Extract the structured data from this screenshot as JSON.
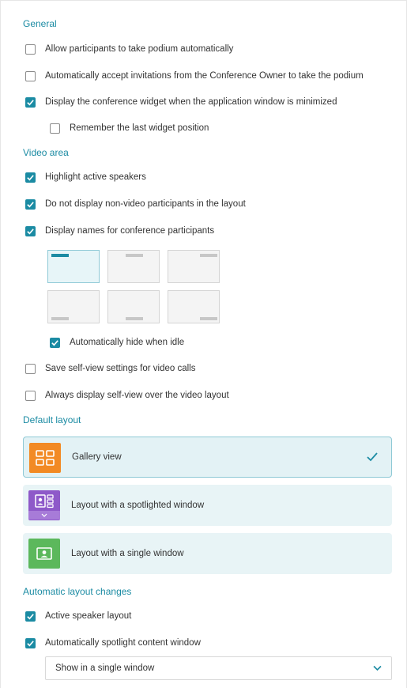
{
  "colors": {
    "accent": "#1b8ba3",
    "gallery_icon_bg": "#f28a24",
    "spotlight_icon_bg": "#8e59c9",
    "single_icon_bg": "#5cb85c"
  },
  "general": {
    "title": "General",
    "options": [
      {
        "label": "Allow participants to take podium automatically",
        "checked": false
      },
      {
        "label": "Automatically accept invitations from the Conference Owner to take the podium",
        "checked": false
      },
      {
        "label": "Display the conference widget when the application window is minimized",
        "checked": true
      },
      {
        "label": "Remember the last widget position",
        "checked": false
      }
    ]
  },
  "video_area": {
    "title": "Video area",
    "options": [
      {
        "label": "Highlight active speakers",
        "checked": true
      },
      {
        "label": "Do not display non-video participants in the layout",
        "checked": true
      },
      {
        "label": "Display names for conference participants",
        "checked": true
      },
      {
        "label": "Automatically hide when idle",
        "checked": true
      },
      {
        "label": "Save self-view settings for video calls",
        "checked": false
      },
      {
        "label": "Always display self-view over the video layout",
        "checked": false
      }
    ],
    "name_position_selected": "top-left"
  },
  "default_layout": {
    "title": "Default layout",
    "items": [
      {
        "label": "Gallery view",
        "icon": "gallery-icon",
        "selected": true
      },
      {
        "label": "Layout with a spotlighted window",
        "icon": "spotlight-layout-icon",
        "selected": false
      },
      {
        "label": "Layout with a single window",
        "icon": "single-window-icon",
        "selected": false
      }
    ]
  },
  "automatic_layout": {
    "title": "Automatic layout changes",
    "options": [
      {
        "label": "Active speaker layout",
        "checked": true
      },
      {
        "label": "Automatically spotlight content window",
        "checked": true
      }
    ],
    "select_value": "Show in a single window"
  }
}
